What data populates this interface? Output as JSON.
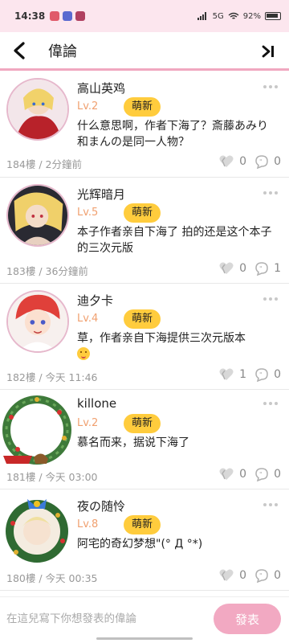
{
  "status_bar": {
    "time": "14:38",
    "battery": "92%",
    "signal_text": "5G"
  },
  "header": {
    "title": "偉論"
  },
  "colors": {
    "accent_pink": "#f2a9c2",
    "level_orange": "#f0a070",
    "badge_yellow": "#ffcc3d"
  },
  "comments": [
    {
      "username": "高山英鸡",
      "level": "Lv.2",
      "badge": "萌新",
      "text": "什么意思啊，作者下海了？斎藤あみり和まんの是同一人物？",
      "floor_time": "184樓 / 2分鐘前",
      "likes": "0",
      "replies": "0"
    },
    {
      "username": "光辉暗月",
      "level": "Lv.5",
      "badge": "萌新",
      "text": "本子作者亲自下海了 拍的还是这个本子的三次元版",
      "floor_time": "183樓 / 36分鐘前",
      "likes": "0",
      "replies": "1"
    },
    {
      "username": "迪夕卡",
      "level": "Lv.4",
      "badge": "萌新",
      "text": "草，作者亲自下海提供三次元版本",
      "floor_time": "182樓 / 今天 11:46",
      "likes": "1",
      "replies": "0"
    },
    {
      "username": "killone",
      "level": "Lv.2",
      "badge": "萌新",
      "text": "慕名而来，据说下海了",
      "floor_time": "181樓 / 今天 03:00",
      "likes": "0",
      "replies": "0"
    },
    {
      "username": "夜の随怜",
      "level": "Lv.8",
      "badge": "萌新",
      "text": "阿宅的奇幻梦想\"(° Д °*)",
      "floor_time": "180樓 / 今天 00:35",
      "likes": "0",
      "replies": "0"
    }
  ],
  "composer": {
    "placeholder": "在這兒寫下你想發表的偉論",
    "send_label": "發表"
  }
}
